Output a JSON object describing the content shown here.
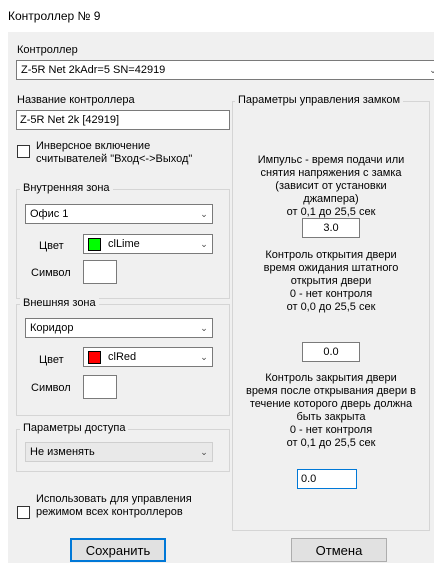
{
  "window": {
    "title": "Контроллер № 9"
  },
  "controller": {
    "label": "Контроллер",
    "value": "Z-5R Net 2kAdr=5 SN=42919"
  },
  "name": {
    "label": "Название контроллера",
    "value": "Z-5R Net 2k [42919]"
  },
  "inverse": {
    "line1": "Инверсное включение",
    "line2": "считывателей \"Вход<->Выход\""
  },
  "inner_zone": {
    "title": "Внутренняя зона",
    "zone": "Офис 1",
    "color_label": "Цвет",
    "color_name": "clLime",
    "color_hex": "#00ff00",
    "symbol_label": "Символ",
    "symbol_value": ""
  },
  "outer_zone": {
    "title": "Внешняя зона",
    "zone": "Коридор",
    "color_label": "Цвет",
    "color_name": "clRed",
    "color_hex": "#ff0000",
    "symbol_label": "Символ",
    "symbol_value": ""
  },
  "access": {
    "title": "Параметры доступа",
    "value": "Не изменять"
  },
  "use_all": {
    "line1": "Использовать для управления",
    "line2": "режимом всех контроллеров"
  },
  "lock": {
    "title": "Параметры управления замком",
    "impulse_lines": [
      "Импульс - время подачи или",
      "снятия напряжения с замка",
      "(зависит от установки",
      "джампера)",
      "от 0,1 до 25,5 сек"
    ],
    "impulse_value": "3.0",
    "open_lines": [
      "Контроль открытия двери",
      "время ожидания штатного",
      "открытия двери",
      "0 - нет контроля",
      "от 0,0 до 25,5 сек"
    ],
    "open_value": "0.0",
    "close_lines": [
      "Контроль закрытия двери",
      "время после открывания двери в",
      "течение которого дверь должна",
      "быть закрыта",
      "0 - нет контроля",
      "от 0,1 до 25,5 сек"
    ],
    "close_value": "0.0"
  },
  "buttons": {
    "save": "Сохранить",
    "cancel": "Отмена"
  }
}
